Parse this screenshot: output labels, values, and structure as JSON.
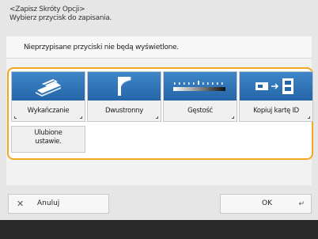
{
  "header": {
    "line1": "<Zapisz Skróty Opcji>",
    "line2": "Wybierz przycisk do zapisania."
  },
  "notice": "Nieprzypisane przyciski nie będą wyświetlone.",
  "options": [
    {
      "label": "Wykańczanie",
      "icon": "stapler-icon"
    },
    {
      "label": "Dwustronny",
      "icon": "duplex-page-icon"
    },
    {
      "label": "Gęstość",
      "icon": "density-slider-icon"
    },
    {
      "label": "Kopiuj kartę ID",
      "icon": "id-card-copy-icon"
    }
  ],
  "favorites": {
    "line1": "Ulubione",
    "line2": "ustawie."
  },
  "footer": {
    "cancel": "Anuluj",
    "ok": "OK"
  },
  "colors": {
    "accent": "#f0a91e",
    "tile_blue": "#2f74b8"
  }
}
